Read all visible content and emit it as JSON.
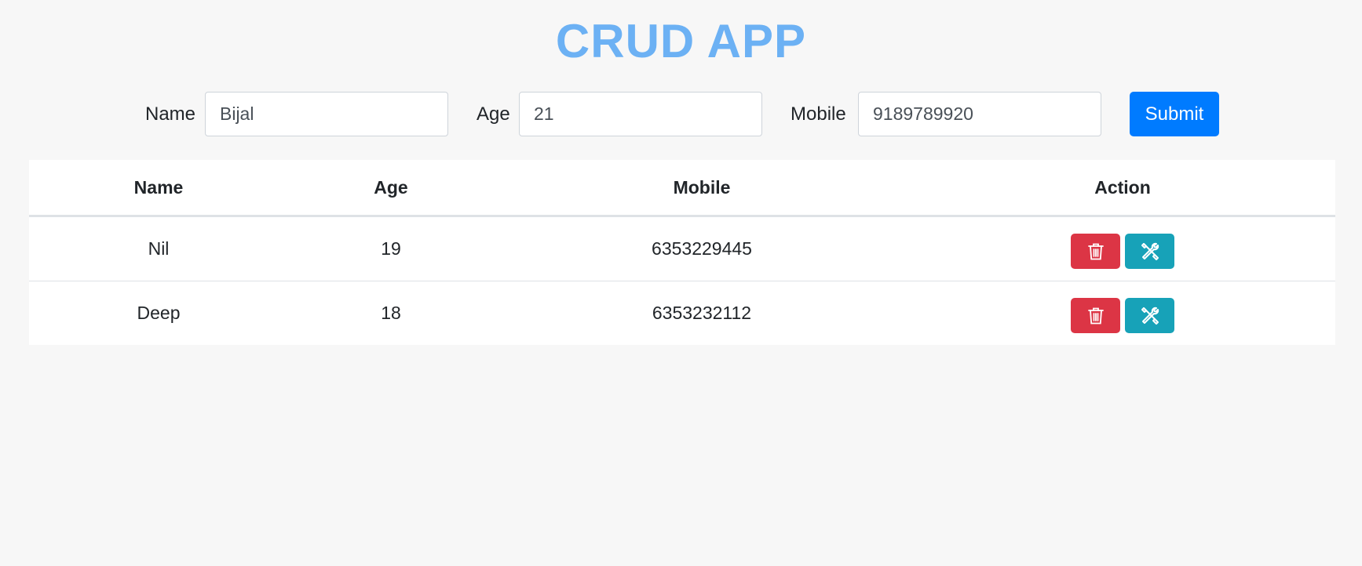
{
  "app": {
    "title": "CRUD APP"
  },
  "form": {
    "name_label": "Name",
    "name_value": "Bijal",
    "age_label": "Age",
    "age_value": "21",
    "mobile_label": "Mobile",
    "mobile_value": "9189789920",
    "submit_label": "Submit"
  },
  "table": {
    "headers": [
      "Name",
      "Age",
      "Mobile",
      "Action"
    ],
    "rows": [
      {
        "name": "Nil",
        "age": "19",
        "mobile": "6353229445"
      },
      {
        "name": "Deep",
        "age": "18",
        "mobile": "6353232112"
      }
    ]
  },
  "icons": {
    "delete": "trash-icon",
    "edit": "tools-icon"
  },
  "colors": {
    "title": "#6cb1f4",
    "submit": "#007bff",
    "delete": "#dc3545",
    "edit": "#17a2b8",
    "background": "#f7f7f7"
  }
}
